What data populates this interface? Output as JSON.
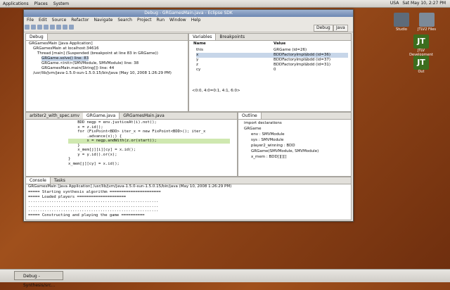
{
  "top_panel": {
    "menus": [
      "Applications",
      "Places",
      "System"
    ],
    "locale": "USA",
    "clock": "Sat May 10, 2:27 PM"
  },
  "window": {
    "title": "Debug - GRGamesMain.java - Eclipse SDK",
    "menus": [
      "File",
      "Edit",
      "Source",
      "Refactor",
      "Navigate",
      "Search",
      "Project",
      "Run",
      "Window",
      "Help"
    ],
    "perspectives": [
      "Debug",
      "Java"
    ]
  },
  "debug_view": {
    "tab": "Debug",
    "rows": [
      "GRGamesMain [Java Application]",
      "GRGamesMain at localhost:34616",
      "Thread [main] (Suspended (breakpoint at line 83 in GRGame))",
      "GRGame.solve() line: 83",
      "GRGame.<init>(SMVModule, SMVModule) line: 38",
      "GRGamesMain.main(String[]) line: 44",
      "/usr/lib/jvm/java-1.5.0-sun-1.5.0.15/bin/java (May 10, 2008 1:26:29 PM)"
    ]
  },
  "variables_view": {
    "tabs": [
      "Variables",
      "Breakpoints"
    ],
    "columns": [
      "Name",
      "Value"
    ],
    "rows": [
      {
        "name": "this",
        "value": "GRGame (id=26)"
      },
      {
        "name": "x",
        "value": "BDDFactoryImpl$bdd (id=36)"
      },
      {
        "name": "y",
        "value": "BDDFactoryImpl$bdd (id=37)"
      },
      {
        "name": "z",
        "value": "BDDFactoryImpl$bdd (id=31)"
      },
      {
        "name": "cy",
        "value": "0"
      }
    ],
    "detail": "<0:0, 4:0=0:1, 4:1, 6:0>"
  },
  "editor": {
    "tabs": [
      "arbiter2_with_spec.smv",
      "GRGame.java",
      "GRGamesMain.java"
    ],
    "lines": [
      "    BDD negp = env.justiceAt(i).not();",
      "    x = z.id();",
      "    for (FixPoint<BDD> iter_x = new FixPoint<BDD>(); iter_x",
      "        .advance(x);) {",
      "        x = negp.andWith(z.or(start));",
      "    }",
      "    x_mem[j][i][cy] = x.id();",
      "    y = y.id().or(x);",
      "}",
      "x_mem[j][cy] = x.id();"
    ]
  },
  "outline_view": {
    "tab": "Outline",
    "rows": [
      "import declarations",
      "GRGame",
      "env : SMVModule",
      "sys : SMVModule",
      "player2_winning : BDD",
      "GRGame(SMVModule, SMVModule)",
      "x_mem : BDD[][][]"
    ]
  },
  "console_view": {
    "tabs": [
      "Console",
      "Tasks"
    ],
    "header": "GRGamesMain [Java Application] /usr/lib/jvm/java-1.5.0-sun-1.5.0.15/bin/java (May 10, 2008 1:26:29 PM)",
    "lines": [
      "===== Starting synthesis algorithm ======================",
      "===== Loaded players =====================",
      "........................................................",
      "........................................................",
      "........................................................",
      "===== Constructing and playing the game =========="
    ]
  },
  "desktop_icons": [
    {
      "label": "Studio"
    },
    {
      "label": "JTLV2 Files"
    },
    {
      "label": "JTLV Development"
    },
    {
      "label": "Out"
    }
  ],
  "taskbar": {
    "item": "Debug - Synthesis/src..."
  }
}
